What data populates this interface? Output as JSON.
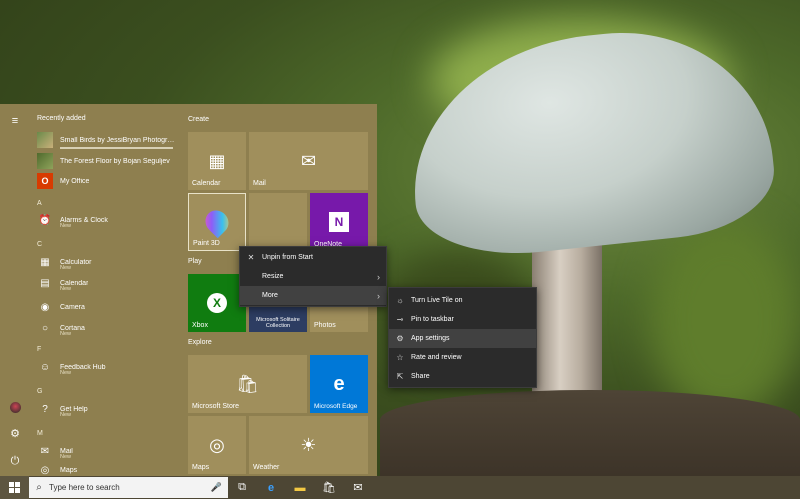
{
  "start_menu": {
    "recently_added_label": "Recently added",
    "create_label": "Create",
    "play_label": "Play",
    "explore_label": "Explore",
    "apps": [
      {
        "name": "Small Birds by JessiBryan Photograp...",
        "icon": "photo-thumb"
      },
      {
        "name": "The Forest Floor by Bojan Šeguljev",
        "icon": "photo-thumb"
      },
      {
        "name": "My Office",
        "icon": "office-icon"
      },
      {
        "name": "Alarms & Clock",
        "new": "New",
        "icon": "alarm-icon"
      },
      {
        "name": "Calculator",
        "new": "New",
        "icon": "calculator-icon"
      },
      {
        "name": "Calendar",
        "new": "New",
        "icon": "calendar-icon"
      },
      {
        "name": "Camera",
        "icon": "camera-icon"
      },
      {
        "name": "Cortana",
        "new": "New",
        "icon": "cortana-icon"
      },
      {
        "name": "Feedback Hub",
        "new": "New",
        "icon": "feedback-icon"
      },
      {
        "name": "Get Help",
        "new": "New",
        "icon": "help-icon"
      },
      {
        "name": "Mail",
        "new": "New",
        "icon": "mail-icon"
      },
      {
        "name": "Maps",
        "icon": "maps-icon"
      }
    ],
    "letters": [
      "A",
      "C",
      "F",
      "G",
      "M"
    ],
    "tiles": {
      "calendar": "Calendar",
      "mail": "Mail",
      "paint3d": "Paint 3D",
      "onenote": "OneNote",
      "xbox": "Xbox",
      "solitaire": "Microsoft Solitaire Collection",
      "photos": "Photos",
      "store": "Microsoft Store",
      "edge": "Microsoft Edge",
      "maps": "Maps",
      "weather": "Weather"
    }
  },
  "context_menu": {
    "unpin": "Unpin from Start",
    "resize": "Resize",
    "more": "More"
  },
  "submenu": {
    "live_tile": "Turn Live Tile on",
    "pin_taskbar": "Pin to taskbar",
    "app_settings": "App settings",
    "rate_review": "Rate and review",
    "share": "Share"
  },
  "taskbar": {
    "search_placeholder": "Type here to search"
  },
  "colors": {
    "accent": "#8e7f4f",
    "tile": "#a08f5c",
    "xbox": "#107c10",
    "onenote": "#7719aa",
    "edge": "#0078d7",
    "menu_bg": "#2b2b2b"
  }
}
